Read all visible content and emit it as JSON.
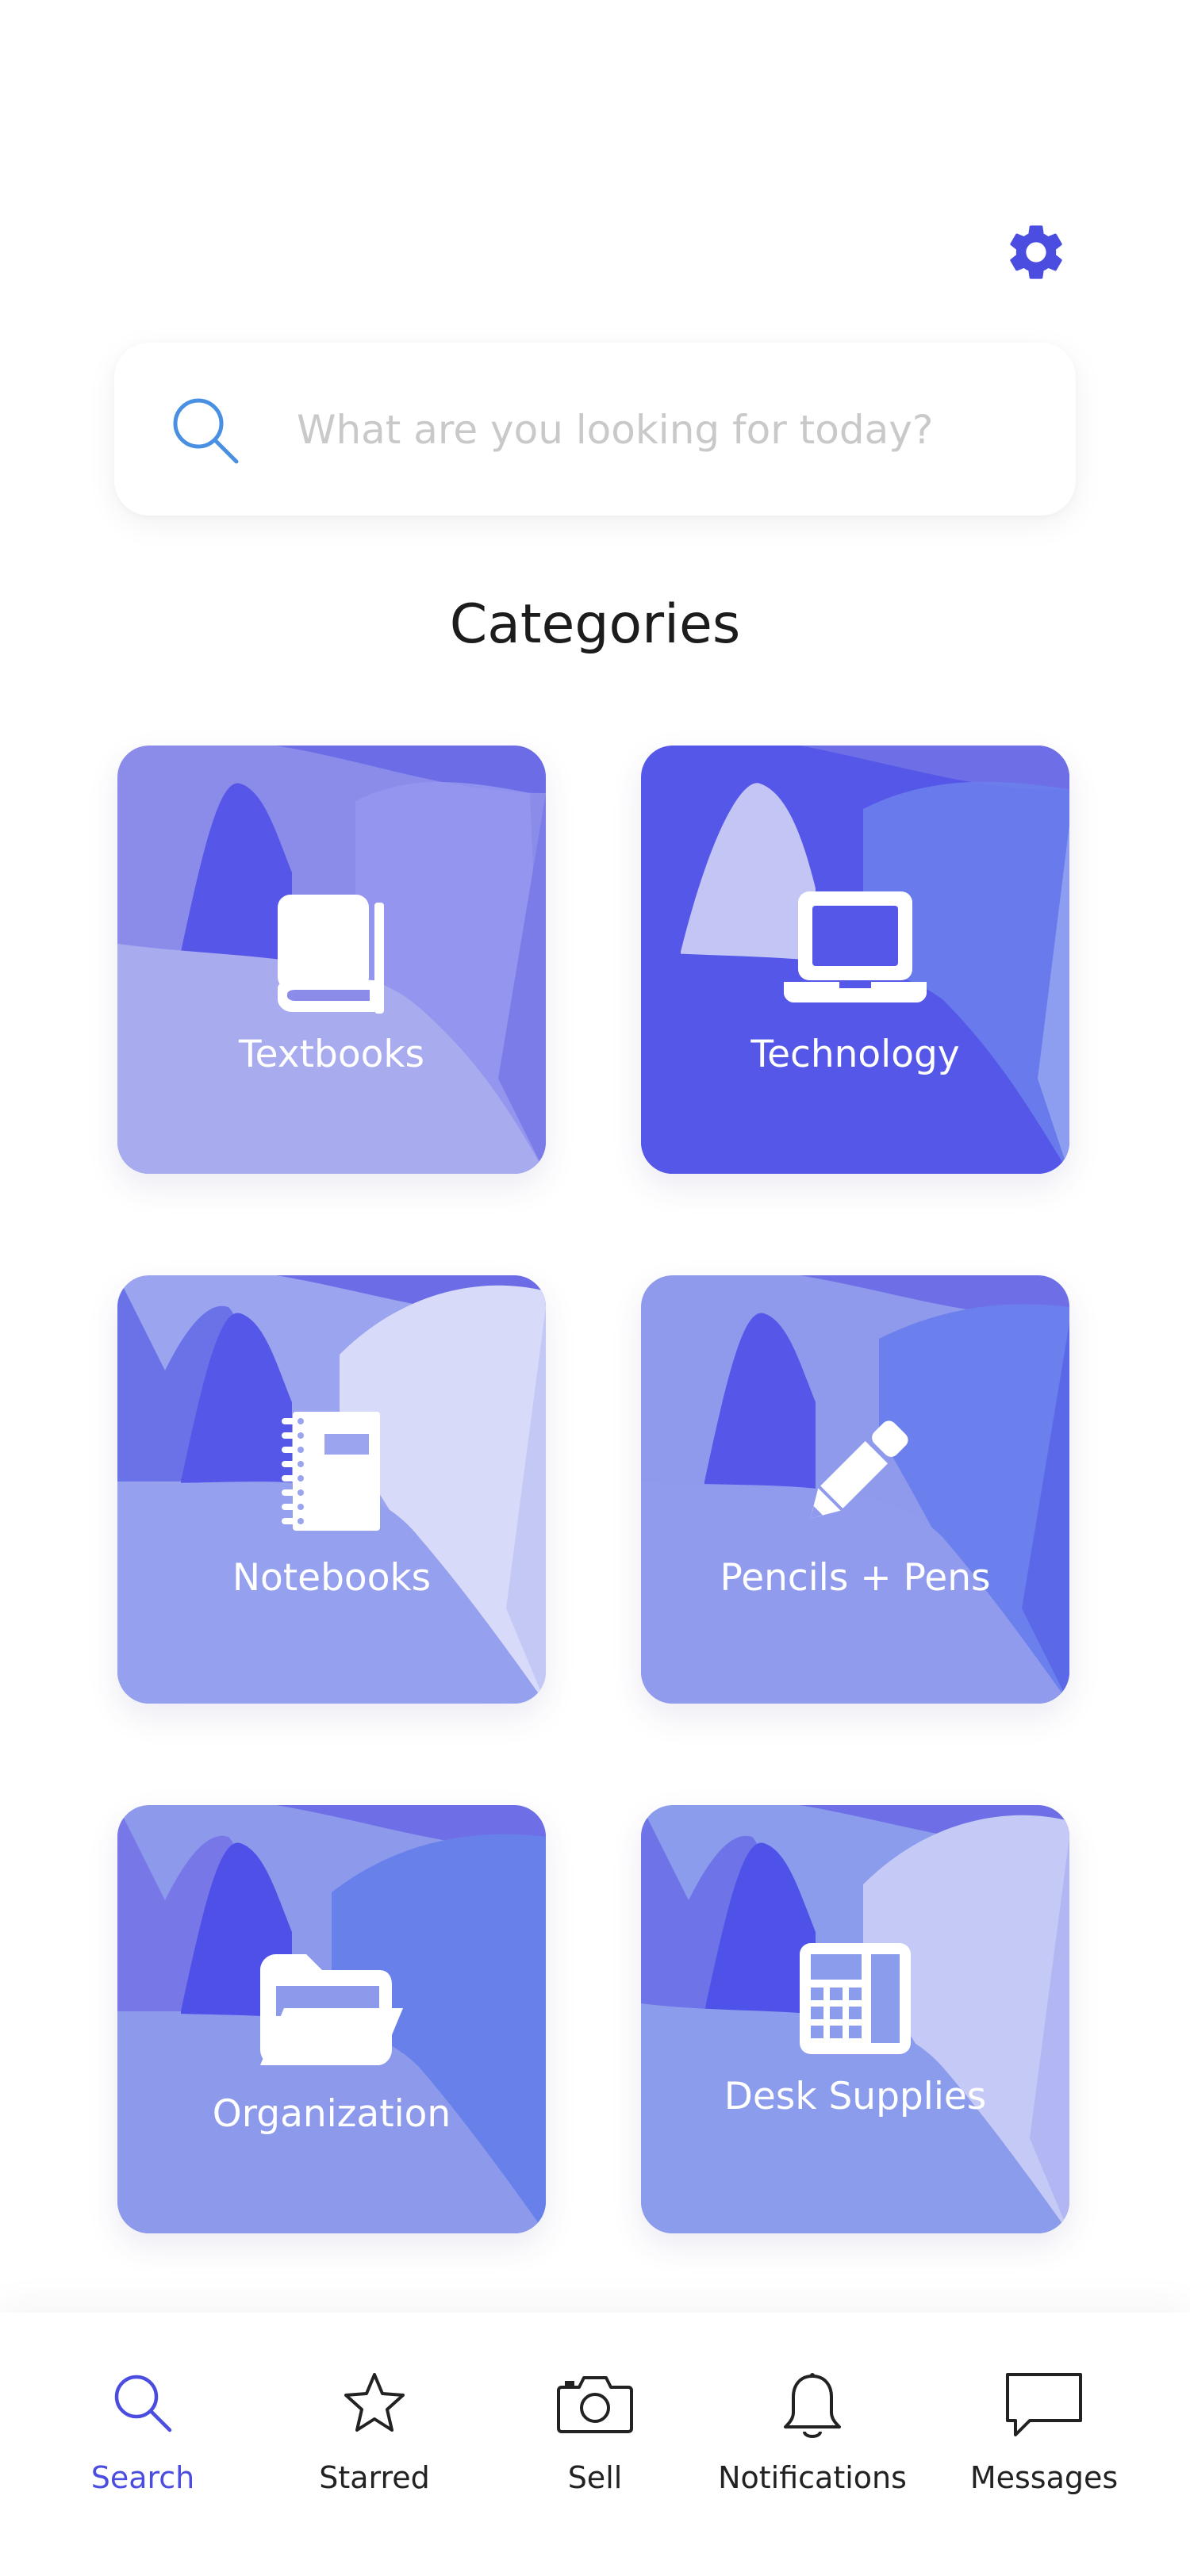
{
  "header": {
    "settings_icon": "gear-icon"
  },
  "search": {
    "placeholder": "What are you looking for today?",
    "value": "",
    "icon": "search-icon"
  },
  "page": {
    "title": "Categories"
  },
  "categories": [
    {
      "label": "Textbooks",
      "icon": "book-icon"
    },
    {
      "label": "Technology",
      "icon": "laptop-icon"
    },
    {
      "label": "Notebooks",
      "icon": "notebook-icon"
    },
    {
      "label": "Pencils + Pens",
      "icon": "pencil-icon"
    },
    {
      "label": "Organization",
      "icon": "folder-icon"
    },
    {
      "label": "Desk Supplies",
      "icon": "calculator-icon"
    }
  ],
  "tabbar": {
    "items": [
      {
        "label": "Search",
        "icon": "search-icon",
        "active": true
      },
      {
        "label": "Starred",
        "icon": "star-icon",
        "active": false
      },
      {
        "label": "Sell",
        "icon": "camera-icon",
        "active": false
      },
      {
        "label": "Notifications",
        "icon": "bell-icon",
        "active": false
      },
      {
        "label": "Messages",
        "icon": "message-icon",
        "active": false
      }
    ]
  },
  "colors": {
    "accent": "#4b4de0",
    "search_icon": "#4a90e2",
    "placeholder": "#c9c9c9",
    "title": "#1c1c1c"
  }
}
